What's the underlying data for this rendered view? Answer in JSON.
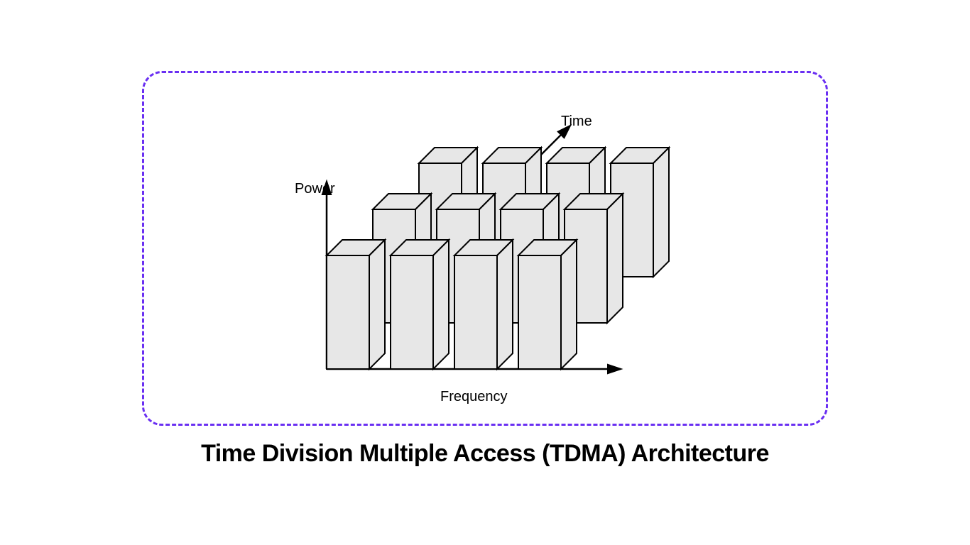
{
  "caption": "Time Division Multiple Access (TDMA) Architecture",
  "axes": {
    "power": "Power",
    "time": "Time",
    "frequency": "Frequency"
  },
  "colors": {
    "border": "#6a2ff2",
    "bar_fill": "#e7e7e7",
    "bar_stroke": "#000000"
  },
  "diagram": {
    "description": "3D grid of rectangular bars on Power-Time-Frequency axes",
    "rows_time": 3,
    "cols_frequency": 4,
    "bars": 12
  }
}
